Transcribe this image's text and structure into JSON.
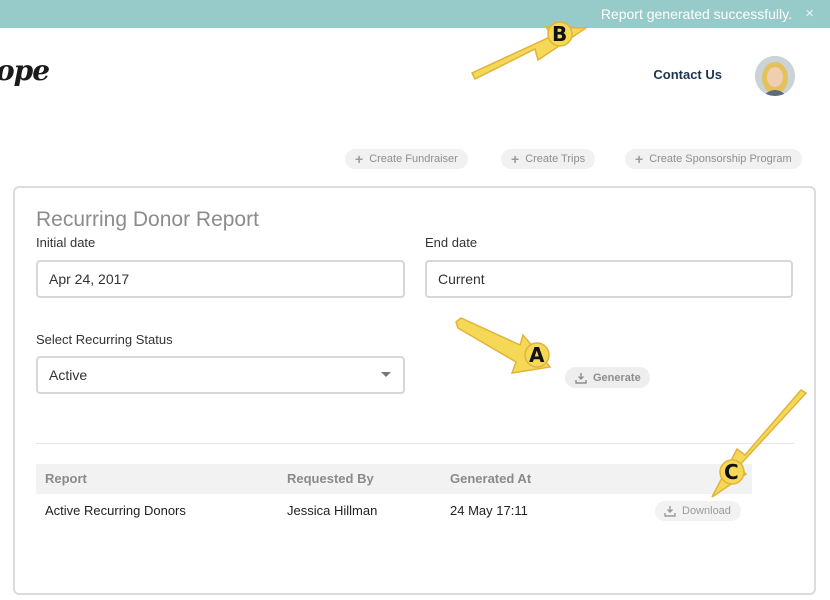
{
  "toast": {
    "message": "Report generated successfully.",
    "close": "×"
  },
  "header": {
    "logo": "ope",
    "contact_label": "Contact Us"
  },
  "actions": {
    "create_fundraiser": "Create Fundraiser",
    "create_trips": "Create Trips",
    "create_sponsorship": "Create Sponsorship Program"
  },
  "report": {
    "title": "Recurring Donor Report",
    "initial_date_label": "Initial date",
    "initial_date_value": "Apr 24, 2017",
    "end_date_label": "End date",
    "end_date_value": "Current",
    "status_label": "Select Recurring Status",
    "status_value": "Active",
    "generate_label": "Generate"
  },
  "table": {
    "headers": [
      "Report",
      "Requested By",
      "Generated At"
    ],
    "rows": [
      {
        "report": "Active Recurring Donors",
        "requested_by": "Jessica Hillman",
        "generated_at": "24 May 17:11",
        "action": "Download"
      }
    ]
  },
  "callouts": {
    "a": "A",
    "b": "B",
    "c": "C"
  },
  "colors": {
    "toast_bg": "#97cbca",
    "contact": "#1c3553",
    "arrow_fill": "#f6d857",
    "arrow_stroke": "#e0b43a"
  }
}
